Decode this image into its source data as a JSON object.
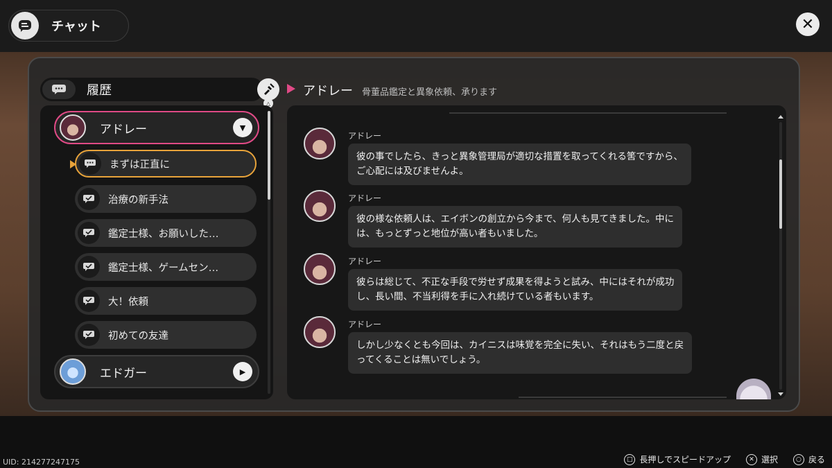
{
  "header": {
    "title": "チャット",
    "icon": "chat-app-icon"
  },
  "close": {
    "icon": "close-icon",
    "glyph": "✕"
  },
  "history": {
    "title": "履歴",
    "contacts": [
      {
        "name": "アドレー",
        "toggle": "▼",
        "active": true
      },
      {
        "name": "エドガー",
        "toggle": "▶",
        "active": false
      }
    ],
    "topics": [
      {
        "label": "まずは正直に",
        "selected": true
      },
      {
        "label": "治療の新手法",
        "selected": false
      },
      {
        "label": "鑑定士様、お願いした…",
        "selected": false
      },
      {
        "label": "鑑定士様、ゲームセン…",
        "selected": false
      },
      {
        "label": "大！依頼",
        "selected": false
      },
      {
        "label": "初めての友達",
        "selected": false
      }
    ],
    "tri_glyph": "△"
  },
  "chat": {
    "name": "アドレー",
    "subtitle": "骨董品鑑定と異象依頼、承ります",
    "messages": [
      {
        "sender": "アドレー",
        "lines": [
          "彼の事でしたら、きっと異象管理局が適切な措置を取ってくれる筈ですから、",
          "ご心配には及びませんよ。"
        ]
      },
      {
        "sender": "アドレー",
        "lines": [
          "彼の様な依頼人は、エイボンの創立から今まで、何人も見てきました。中に",
          "は、もっとずっと地位が高い者もいました。"
        ]
      },
      {
        "sender": "アドレー",
        "lines": [
          "彼らは総じて、不正な手段で労せず成果を得ようと試み、中にはそれが成功",
          "し、長い間、不当利得を手に入れ続けている者もいます。"
        ]
      },
      {
        "sender": "アドレー",
        "lines": [
          "しかし少なくとも今回は、カイニスは味覚を完全に失い、それはもう二度と戻",
          "ってくることは無いでしょう。"
        ]
      }
    ]
  },
  "footer": {
    "uid": "UID: 214277247175",
    "hints": [
      {
        "glyph": "□",
        "label": "長押しでスピードアップ"
      },
      {
        "glyph": "✕",
        "label": "選択"
      },
      {
        "glyph": "○",
        "label": "戻る"
      }
    ]
  },
  "colors": {
    "accent_pink": "#e04a86",
    "accent_orange": "#e8a33a"
  }
}
